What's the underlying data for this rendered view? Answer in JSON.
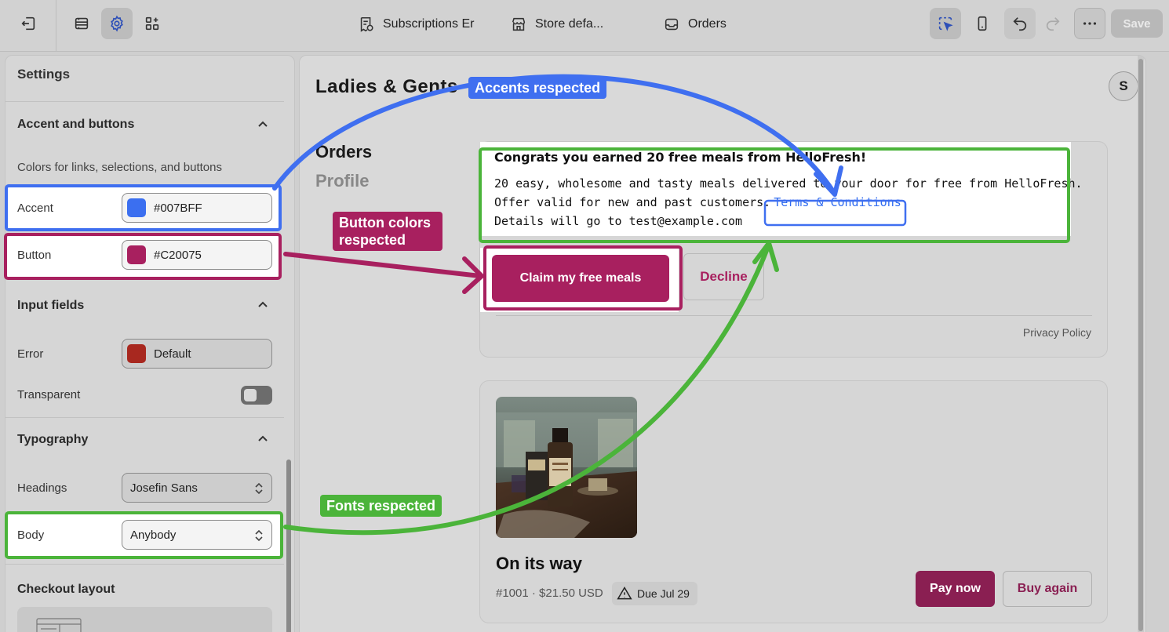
{
  "topbar": {
    "tabs": [
      {
        "label": "Subscriptions Er",
        "icon": "receipt-icon"
      },
      {
        "label": "Store defa...",
        "icon": "store-icon"
      },
      {
        "label": "Orders",
        "icon": "inbox-icon"
      }
    ],
    "save_label": "Save"
  },
  "settings": {
    "title": "Settings",
    "accent_section": {
      "title": "Accent and buttons",
      "help": "Colors for links, selections, and buttons",
      "accent_label": "Accent",
      "accent_value": "#007BFF",
      "button_label": "Button",
      "button_value": "#C20075"
    },
    "input_section": {
      "title": "Input fields",
      "error_label": "Error",
      "error_value": "Default",
      "transparent_label": "Transparent"
    },
    "typography_section": {
      "title": "Typography",
      "headings_label": "Headings",
      "headings_value": "Josefin Sans",
      "body_label": "Body",
      "body_value": "Anybody"
    },
    "checkout_layout_title": "Checkout layout"
  },
  "preview": {
    "shop_name": "Ladies & Gents",
    "avatar_letter": "S",
    "nav": {
      "orders": "Orders",
      "profile": "Profile"
    },
    "offer": {
      "title": "Congrats you earned 20 free meals from HelloFresh!",
      "line1": "20 easy, wholesome and tasty meals delivered to your door for free from HelloFresh.",
      "line2": "Offer valid for new and past customers.",
      "terms": "Terms & Conditions",
      "line3": "Details will go to test@example.com",
      "claim_label": "Claim my free meals",
      "decline_label": "Decline",
      "privacy": "Privacy Policy"
    },
    "order": {
      "title": "On its way",
      "meta": "#1001 · $21.50 USD",
      "due": "Due Jul 29",
      "pay_label": "Pay now",
      "buy_label": "Buy again"
    }
  },
  "annotations": {
    "accents": "Accents respected",
    "buttons_line1": "Button colors",
    "buttons_line2": "respected",
    "fonts": "Fonts respected"
  },
  "colors": {
    "accent": "#007BFF",
    "button": "#C20075",
    "error": "#a8281f",
    "highlight_blue": "#3f6ff0",
    "highlight_magenta": "#a8205f",
    "highlight_green": "#4bb43a"
  }
}
